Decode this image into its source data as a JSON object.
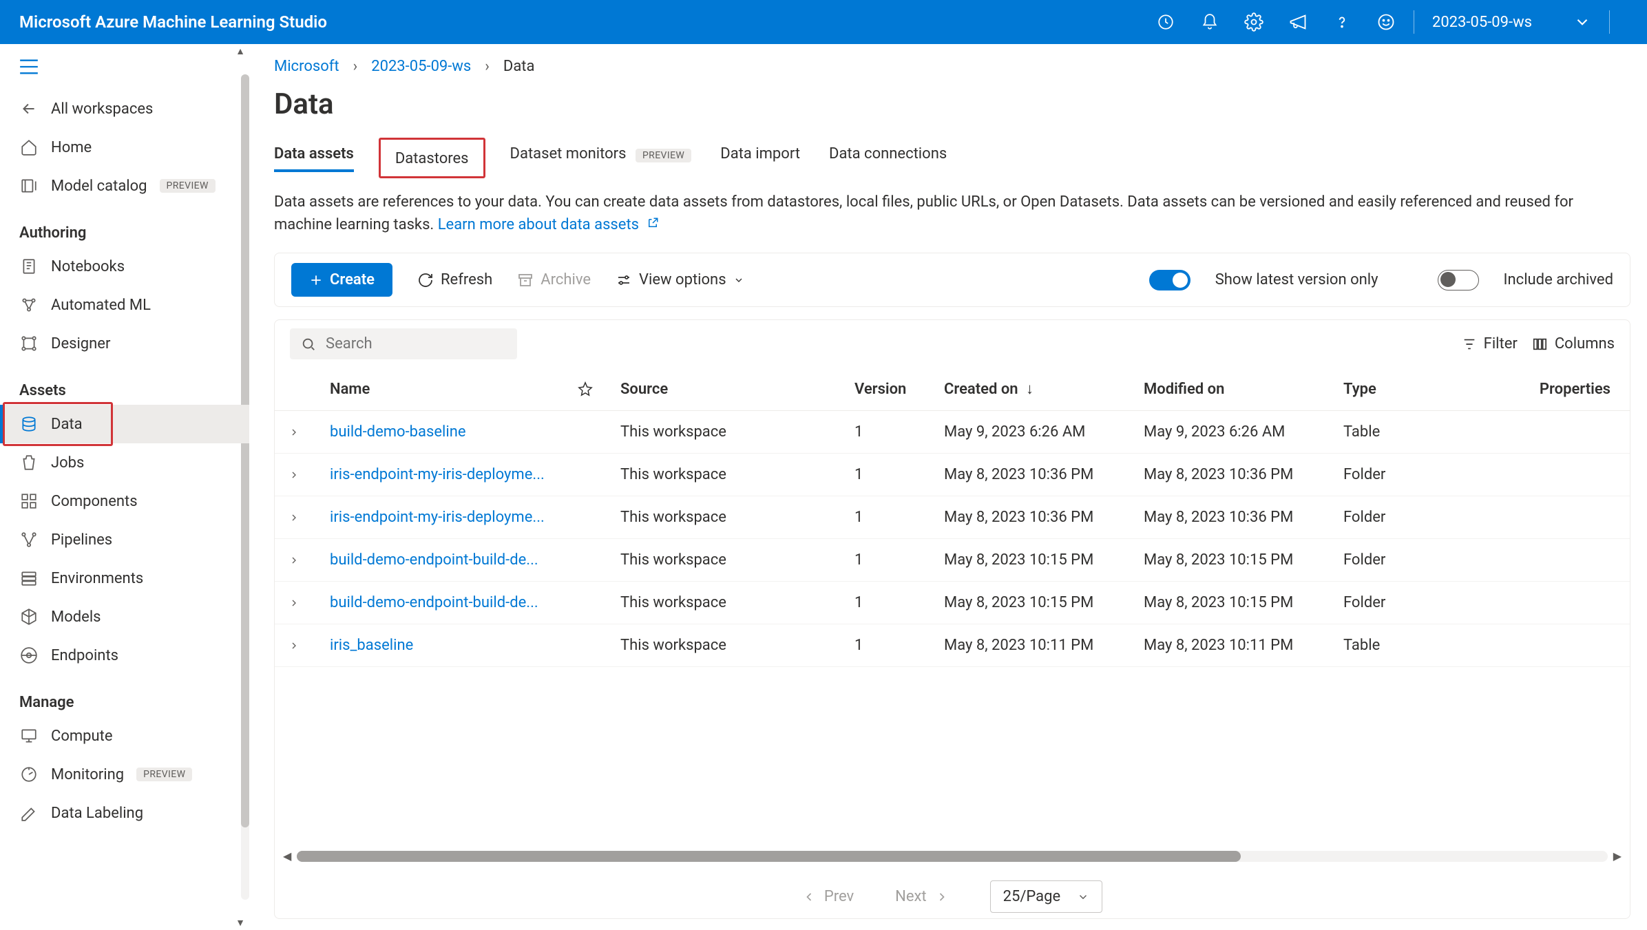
{
  "topbar": {
    "title": "Microsoft Azure Machine Learning Studio",
    "workspace": "2023-05-09-ws"
  },
  "breadcrumb": {
    "root": "Microsoft",
    "workspace": "2023-05-09-ws",
    "current": "Data"
  },
  "page_title": "Data",
  "sidebar": {
    "all_workspaces": "All workspaces",
    "home": "Home",
    "model_catalog": "Model catalog",
    "preview_badge": "PREVIEW",
    "section_authoring": "Authoring",
    "notebooks": "Notebooks",
    "automated_ml": "Automated ML",
    "designer": "Designer",
    "section_assets": "Assets",
    "data": "Data",
    "jobs": "Jobs",
    "components": "Components",
    "pipelines": "Pipelines",
    "environments": "Environments",
    "models": "Models",
    "endpoints": "Endpoints",
    "section_manage": "Manage",
    "compute": "Compute",
    "monitoring": "Monitoring",
    "data_labeling": "Data Labeling"
  },
  "tabs": {
    "data_assets": "Data assets",
    "datastores": "Datastores",
    "dataset_monitors": "Dataset monitors",
    "preview_badge": "PREVIEW",
    "data_import": "Data import",
    "data_connections": "Data connections"
  },
  "description": {
    "text": "Data assets are references to your data. You can create data assets from datastores, local files, public URLs, or Open Datasets. Data assets can be versioned and easily referenced and reused for machine learning tasks. ",
    "link": "Learn more about data assets"
  },
  "toolbar": {
    "create": "Create",
    "refresh": "Refresh",
    "archive": "Archive",
    "view_options": "View options",
    "show_latest": "Show latest version only",
    "include_archived": "Include archived"
  },
  "table_tools": {
    "search_placeholder": "Search",
    "filter": "Filter",
    "columns": "Columns"
  },
  "columns": {
    "name": "Name",
    "source": "Source",
    "version": "Version",
    "created_on": "Created on",
    "modified_on": "Modified on",
    "type": "Type",
    "properties": "Properties"
  },
  "rows": [
    {
      "name": "build-demo-baseline",
      "source": "This workspace",
      "version": "1",
      "created": "May 9, 2023 6:26 AM",
      "modified": "May 9, 2023 6:26 AM",
      "type": "Table"
    },
    {
      "name": "iris-endpoint-my-iris-deployme...",
      "source": "This workspace",
      "version": "1",
      "created": "May 8, 2023 10:36 PM",
      "modified": "May 8, 2023 10:36 PM",
      "type": "Folder"
    },
    {
      "name": "iris-endpoint-my-iris-deployme...",
      "source": "This workspace",
      "version": "1",
      "created": "May 8, 2023 10:36 PM",
      "modified": "May 8, 2023 10:36 PM",
      "type": "Folder"
    },
    {
      "name": "build-demo-endpoint-build-de...",
      "source": "This workspace",
      "version": "1",
      "created": "May 8, 2023 10:15 PM",
      "modified": "May 8, 2023 10:15 PM",
      "type": "Folder"
    },
    {
      "name": "build-demo-endpoint-build-de...",
      "source": "This workspace",
      "version": "1",
      "created": "May 8, 2023 10:15 PM",
      "modified": "May 8, 2023 10:15 PM",
      "type": "Folder"
    },
    {
      "name": "iris_baseline",
      "source": "This workspace",
      "version": "1",
      "created": "May 8, 2023 10:11 PM",
      "modified": "May 8, 2023 10:11 PM",
      "type": "Table"
    }
  ],
  "pager": {
    "prev": "Prev",
    "next": "Next",
    "page_size": "25/Page"
  }
}
